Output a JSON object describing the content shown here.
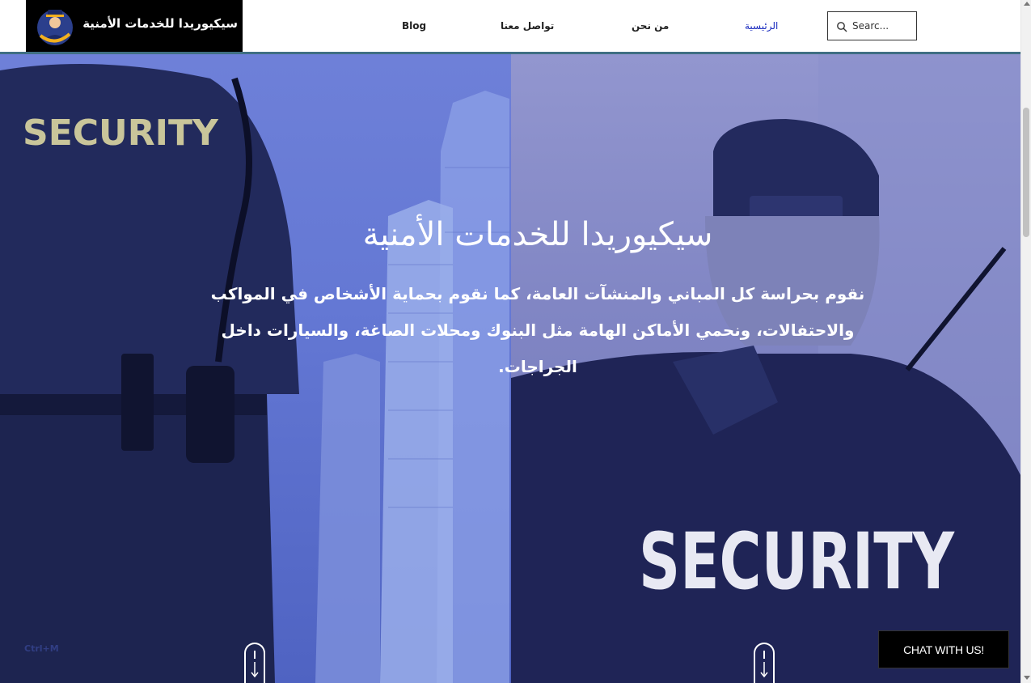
{
  "header": {
    "logo_text": "سيكيوريدا للخدمات الأمنية",
    "nav": {
      "blog": "Blog",
      "contact": "تواصل معنا",
      "about": "من نحن",
      "home": "الرئيسية"
    },
    "search": {
      "placeholder": "Searc..."
    }
  },
  "hero": {
    "heading": "سيكيوريدا للخدمات الأمنية",
    "body": "نقوم بحراسة كل المباني والمنشآت العامة، كما نقوم بحماية الأشخاص في المواكب والاحتفالات، ونحمي الأماكن الهامة مثل البنوك ومحلات الصاغة، والسيارات داخل الجراجات."
  },
  "overlay": {
    "ctrl_hint": "Ctrl+M"
  },
  "chat": {
    "label": "CHAT WITH US!"
  },
  "colors": {
    "header_line": "#3f6f83",
    "nav_active": "#1a2bbf",
    "hero_left_tint": "#6478d4",
    "hero_right_tint": "#8186c4"
  },
  "icons": {
    "logo": "security-guard-emblem-icon",
    "search": "search-icon",
    "scroll_hint": "mouse-scroll-down-icon"
  }
}
